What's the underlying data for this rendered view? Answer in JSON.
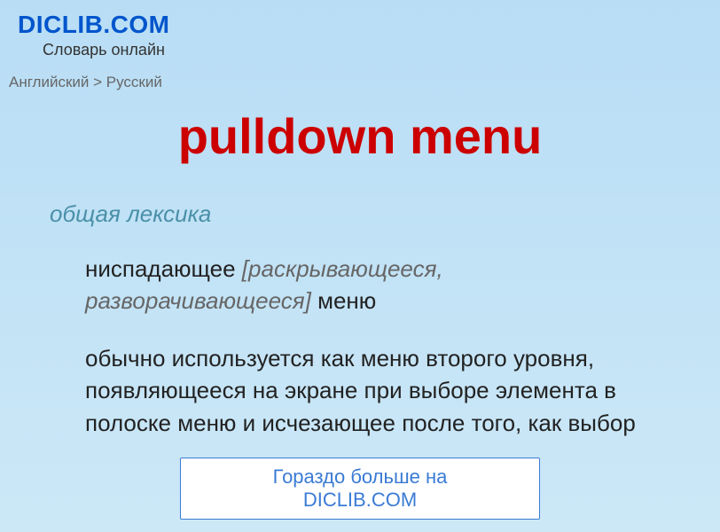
{
  "header": {
    "logo": "DICLIB.COM",
    "subtitle": "Словарь онлайн"
  },
  "breadcrumb": "Английский > Русский",
  "term": "pulldown menu",
  "category": "общая лексика",
  "definition": {
    "prefix": "ниспадающее ",
    "italic": "[раскрывающееся, разворачивающееся]",
    "suffix": " меню"
  },
  "usage": "обычно используется как меню второго уровня, появляющееся на экране при выборе элемента в полоске меню и исчезающее после того, как выбор",
  "footer_button": "Гораздо больше на DICLIB.COM"
}
